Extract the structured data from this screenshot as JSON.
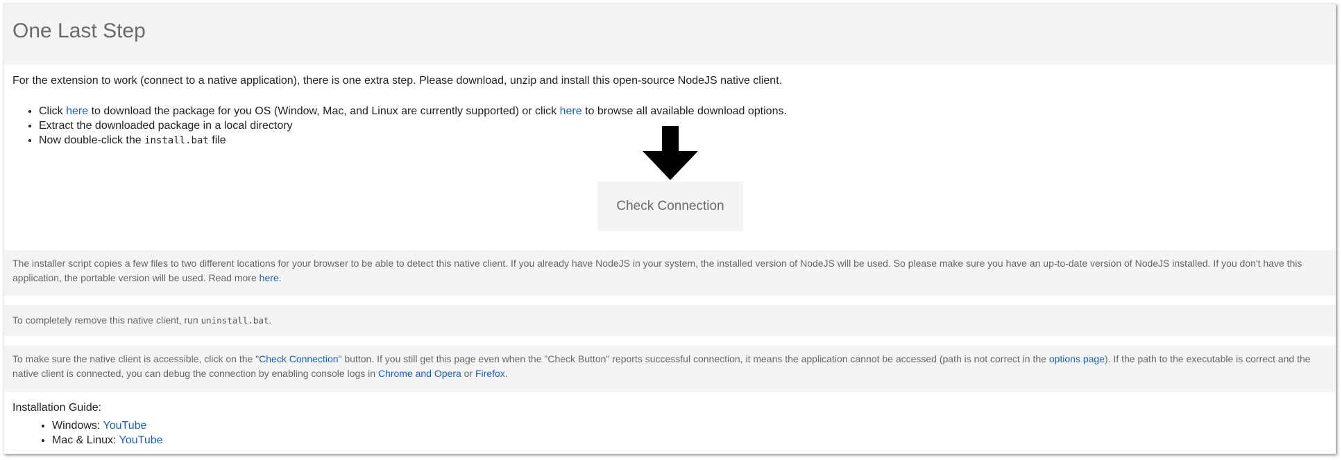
{
  "page": {
    "title": "One Last Step",
    "intro": "For the extension to work (connect to a native application), there is one extra step. Please download, unzip and install this open-source NodeJS native client."
  },
  "steps": {
    "item1": {
      "pre": "Click ",
      "link1": "here",
      "mid": " to download the package for you OS (Window, Mac, and Linux are currently supported) or click ",
      "link2": "here",
      "post": " to browse all available download options."
    },
    "item2": {
      "text": "Extract the downloaded package in a local directory"
    },
    "item3": {
      "pre": "Now double-click the ",
      "code": "install.bat",
      "post": " file"
    }
  },
  "arrow": {
    "icon": "down-arrow-icon",
    "color": "#000000"
  },
  "check_button": {
    "label": "Check Connection"
  },
  "notes": {
    "installer": {
      "text": "The installer script copies a few files to two different locations for your browser to be able to detect this native client. If you already have NodeJS in your system, the installed version of NodeJS will be used. So please make sure you have an up-to-date version of NodeJS installed. If you don't have this application, the portable version will be used. Read more ",
      "link": "here",
      "post": "."
    },
    "uninstall": {
      "text": "To completely remove this native client, run ",
      "code": "uninstall.bat",
      "post": "."
    },
    "access": {
      "t1": "To make sure the native client is accessible, click on the \"",
      "link1": "Check Connection",
      "t2": "\" button. If you still get this page even when the \"Check Button\" reports successful connection, it means the application cannot be accessed (path is not correct in the ",
      "link2": "options page",
      "t3": "). If the path to the executable is correct and the native client is connected, you can debug the connection by enabling console logs in ",
      "link3": "Chrome and Opera",
      "t4": " or ",
      "link4": "Firefox",
      "t5": "."
    }
  },
  "guide": {
    "label": "Installation Guide:",
    "items": [
      {
        "os": "Windows: ",
        "link": "YouTube"
      },
      {
        "os": "Mac & Linux: ",
        "link": "YouTube"
      }
    ]
  },
  "colors": {
    "link": "#1a5fb4",
    "panel": "#f4f4f4",
    "title": "#6b6b6b"
  }
}
